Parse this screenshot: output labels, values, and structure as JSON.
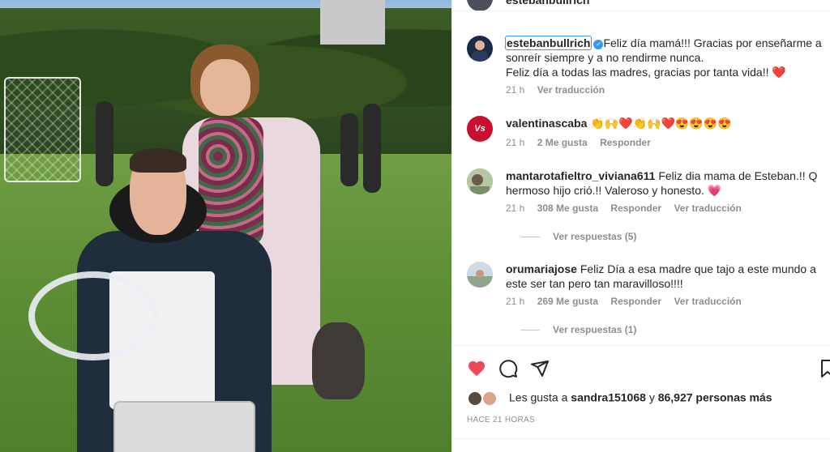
{
  "header": {
    "username": "estebanbullrich"
  },
  "post_image": {
    "alt": ""
  },
  "caption": {
    "username": "estebanbullrich",
    "verified": true,
    "line1": "Feliz día mamá!!! Gracias por enseñarme a sonreír siempre y a no rendirme nunca.",
    "line2": "Feliz día a todas las madres, gracias por tanta vida!! ❤️",
    "time": "21 h",
    "translate": "Ver traducción"
  },
  "comments": [
    {
      "username": "valentinascaba",
      "text": "👏🙌❤️👏🙌❤️😍😍😍😍",
      "time": "21 h",
      "likes": "2 Me gusta",
      "reply": "Responder",
      "translate": "",
      "avatar_color": "#c8102e",
      "avatar_text": "Vs"
    },
    {
      "username": "mantarotafieltro_viviana611",
      "text": "Feliz dia mama de Esteban.!! Q hermoso hijo crió.!! Valeroso y honesto. 💗",
      "time": "21 h",
      "likes": "308 Me gusta",
      "reply": "Responder",
      "translate": "Ver traducción",
      "replies": "Ver respuestas (5)",
      "avatar_color": "#8aa07a"
    },
    {
      "username": "orumariajose",
      "text": "Feliz Día a esa madre que tajo a este mundo a este ser tan pero tan maravilloso!!!!",
      "time": "21 h",
      "likes": "269 Me gusta",
      "reply": "Responder",
      "translate": "Ver traducción",
      "replies": "Ver respuestas (1)",
      "avatar_color": "#9fb7c9"
    }
  ],
  "actions": {
    "like_icon": "heart-filled-icon",
    "comment_icon": "comment-bubble-icon",
    "share_icon": "paper-plane-icon",
    "save_icon": "bookmark-icon",
    "heart_color": "#ed4956"
  },
  "likes": {
    "prefix": "Les gusta a",
    "user": "sandra151068",
    "connector": "y",
    "count": "86,927 personas más"
  },
  "timestamp": "HACE 21 HORAS"
}
